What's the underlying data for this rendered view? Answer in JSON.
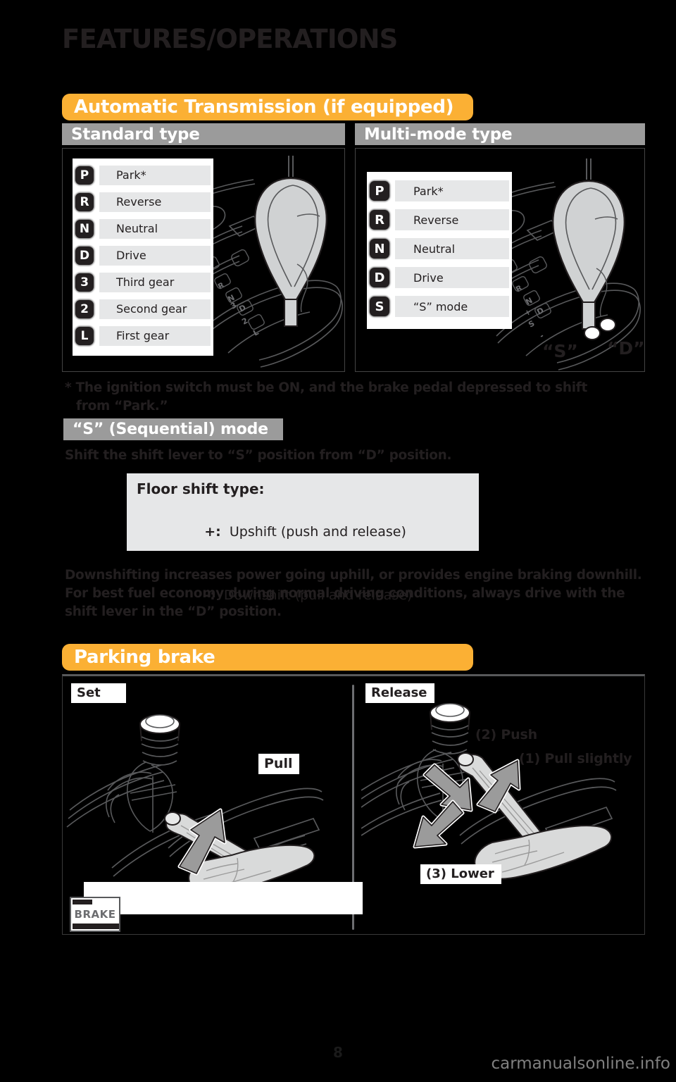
{
  "masthead": {
    "title": "FEATURES/OPERATIONS"
  },
  "sections": {
    "automatic_transmission": {
      "banner_label": "Automatic Transmission (if equipped)",
      "standard": {
        "header": "Standard type",
        "gears": [
          {
            "badge": "P",
            "label": "Park*"
          },
          {
            "badge": "R",
            "label": "Reverse"
          },
          {
            "badge": "N",
            "label": "Neutral"
          },
          {
            "badge": "D",
            "label": "Drive"
          },
          {
            "badge": "3",
            "label": "Third gear"
          },
          {
            "badge": "2",
            "label": "Second gear"
          },
          {
            "badge": "L",
            "label": "First gear"
          }
        ]
      },
      "multimode": {
        "header": "Multi-mode type",
        "gears": [
          {
            "badge": "P",
            "label": "Park*"
          },
          {
            "badge": "R",
            "label": "Reverse"
          },
          {
            "badge": "N",
            "label": "Neutral"
          },
          {
            "badge": "D",
            "label": "Drive"
          },
          {
            "badge": "S",
            "label": "“S” mode"
          }
        ],
        "gate_labels": {
          "s": "“S”",
          "d": "“D”"
        }
      },
      "footnote_line1": "* The ignition switch must be ON, and the brake pedal depressed to shift",
      "footnote_line2": "from “Park.”"
    },
    "sequential_mode": {
      "header": "“S” (Sequential) mode",
      "intro": "Shift the shift lever to “S” position from “D” position.",
      "floor_shift": {
        "title": "Floor shift type:",
        "upshift_sign": "+:",
        "upshift_text": "  Upshift (push and release)",
        "downshift_sign": "-:",
        "downshift_text": "  Downshift (pull and release)"
      },
      "note": "Downshifting increases power going uphill, or provides engine braking downhill. For best fuel economy during normal driving conditions, always drive with the shift lever in the “D” position."
    },
    "parking_brake": {
      "banner_label": "Parking brake",
      "set": {
        "tag": "Set",
        "arrow_label": "Pull"
      },
      "release": {
        "tag": "Release",
        "step1": "(1) Pull slightly",
        "step2": "(2) Push",
        "step3": "(3) Lower"
      },
      "indicator_label": "BRAKE"
    }
  },
  "footer": {
    "page_number": "8",
    "watermark": "carmanualsonline.info"
  },
  "colors": {
    "banner_orange": "#fbb034",
    "subhead_gray": "#9b9b9b",
    "label_gray": "#e6e7e8",
    "ink": "#231f20",
    "page_background": "#000000"
  }
}
